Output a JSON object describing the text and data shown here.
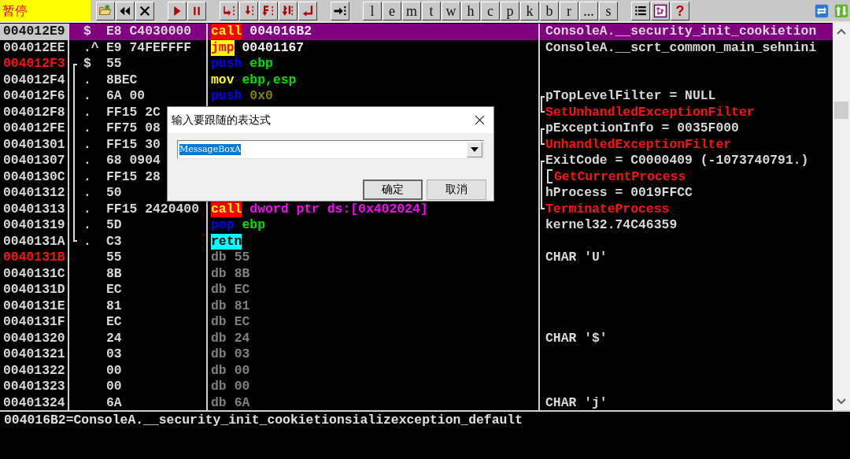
{
  "toolbar": {
    "status": "暂停",
    "groups": [
      [
        {
          "kind": "open"
        },
        {
          "kind": "rewind"
        },
        {
          "kind": "close"
        }
      ],
      [
        {
          "kind": "run"
        },
        {
          "kind": "pause"
        }
      ],
      [
        {
          "kind": "step-into"
        },
        {
          "kind": "step-over"
        },
        {
          "kind": "trace-into"
        },
        {
          "kind": "trace-over"
        },
        {
          "kind": "till-return"
        }
      ],
      [
        {
          "kind": "goto"
        }
      ],
      [
        {
          "kind": "letter",
          "label": "l"
        },
        {
          "kind": "letter",
          "label": "e"
        },
        {
          "kind": "letter",
          "label": "m"
        },
        {
          "kind": "letter",
          "label": "t"
        },
        {
          "kind": "letter",
          "label": "w"
        },
        {
          "kind": "letter",
          "label": "h"
        },
        {
          "kind": "letter",
          "label": "c"
        },
        {
          "kind": "letter",
          "label": "p"
        },
        {
          "kind": "letter",
          "label": "k"
        },
        {
          "kind": "letter",
          "label": "b"
        },
        {
          "kind": "letter",
          "label": "r"
        },
        {
          "kind": "letter",
          "label": "..."
        },
        {
          "kind": "letter",
          "label": "s"
        }
      ],
      [
        {
          "kind": "list"
        },
        {
          "kind": "windows"
        },
        {
          "kind": "letter-help",
          "label": "?"
        }
      ],
      [
        {
          "kind": "swap"
        },
        {
          "kind": "updown"
        }
      ]
    ]
  },
  "disassembly": {
    "rows": [
      {
        "address": "004012E9",
        "breakpoint": false,
        "selected": true,
        "in_jump_bracket": false,
        "marker": "$",
        "hex": "E8 C4030000",
        "mnemonic": "call",
        "operands": [
          {
            "text": "004016B2",
            "kind": "address"
          }
        ],
        "comment": {
          "text": "ConsoleA.__security_init_cookietion",
          "kind": "note",
          "in_bracket": false
        }
      },
      {
        "address": "004012EE",
        "breakpoint": false,
        "selected": false,
        "in_jump_bracket": false,
        "marker": ".^",
        "hex": "E9 74FEFFFF",
        "mnemonic": "jmp",
        "operands": [
          {
            "text": "00401167",
            "kind": "address"
          }
        ],
        "comment": {
          "text": "ConsoleA.__scrt_common_main_sehnini",
          "kind": "note",
          "in_bracket": false
        }
      },
      {
        "address": "004012F3",
        "breakpoint": true,
        "selected": false,
        "in_jump_bracket": true,
        "marker": "$",
        "hex": "55",
        "mnemonic": "push",
        "operands": [
          {
            "text": "ebp",
            "kind": "register"
          }
        ]
      },
      {
        "address": "004012F4",
        "breakpoint": false,
        "selected": false,
        "in_jump_bracket": true,
        "marker": ".",
        "hex": "8BEC",
        "mnemonic": "mov",
        "operands": [
          {
            "text": "ebp,esp",
            "kind": "register"
          }
        ]
      },
      {
        "address": "004012F6",
        "breakpoint": false,
        "selected": false,
        "in_jump_bracket": true,
        "marker": ".",
        "hex": "6A 00",
        "mnemonic": "push",
        "operands": [
          {
            "text": "0x0",
            "kind": "const"
          }
        ],
        "comment": {
          "text": "pTopLevelFilter = NULL",
          "kind": "note",
          "in_bracket": true,
          "bracket_start": true,
          "call_bracket": false
        }
      },
      {
        "address": "004012F8",
        "breakpoint": false,
        "selected": false,
        "in_jump_bracket": true,
        "marker": ".",
        "hex": "FF15 2C",
        "comment": {
          "text": "SetUnhandledExceptionFilter",
          "kind": "api",
          "in_bracket": true,
          "bracket_start": false,
          "call_bracket": false
        }
      },
      {
        "address": "004012FE",
        "breakpoint": false,
        "selected": false,
        "in_jump_bracket": true,
        "marker": ".",
        "hex": "FF75 08",
        "comment": {
          "text": "pExceptionInfo = 0035F000",
          "kind": "note",
          "in_bracket": true,
          "bracket_start": true,
          "call_bracket": false
        }
      },
      {
        "address": "00401301",
        "breakpoint": false,
        "selected": false,
        "in_jump_bracket": true,
        "marker": ".",
        "hex": "FF15 30",
        "comment": {
          "text": "UnhandledExceptionFilter",
          "kind": "api",
          "in_bracket": true,
          "bracket_start": false,
          "call_bracket": false
        }
      },
      {
        "address": "00401307",
        "breakpoint": false,
        "selected": false,
        "in_jump_bracket": true,
        "marker": ".",
        "hex": "68 0904",
        "comment": {
          "text": "ExitCode = C0000409 (-1073740791.)",
          "kind": "note",
          "in_bracket": true,
          "bracket_start": true,
          "call_bracket": false
        }
      },
      {
        "address": "0040130C",
        "breakpoint": false,
        "selected": false,
        "in_jump_bracket": true,
        "marker": ".",
        "hex": "FF15 28",
        "comment": {
          "text": "GetCurrentProcess",
          "kind": "api",
          "in_bracket": true,
          "bracket_start": false,
          "call_bracket": true
        }
      },
      {
        "address": "00401312",
        "breakpoint": false,
        "selected": false,
        "in_jump_bracket": true,
        "marker": ".",
        "hex": "50",
        "comment": {
          "text": "hProcess = 0019FFCC",
          "kind": "note",
          "in_bracket": true,
          "bracket_start": false,
          "call_bracket": false
        }
      },
      {
        "address": "00401313",
        "breakpoint": false,
        "selected": false,
        "in_jump_bracket": true,
        "marker": ".",
        "hex": "FF15 2420400",
        "mnemonic": "call",
        "operands": [
          {
            "text": "dword ptr ds:[0x402024]",
            "kind": "memory"
          }
        ],
        "comment": {
          "text": "TerminateProcess",
          "kind": "api",
          "in_bracket": true,
          "bracket_start": false,
          "call_bracket": false
        }
      },
      {
        "address": "00401319",
        "breakpoint": false,
        "selected": false,
        "in_jump_bracket": true,
        "marker": ".",
        "hex": "5D",
        "mnemonic": "pop",
        "operands": [
          {
            "text": "ebp",
            "kind": "register"
          }
        ],
        "comment": {
          "text": "kernel32.74C46359",
          "kind": "note",
          "in_bracket": false
        }
      },
      {
        "address": "0040131A",
        "breakpoint": false,
        "selected": false,
        "in_jump_bracket": true,
        "marker": ".",
        "hex": "C3",
        "mnemonic": "retn"
      },
      {
        "address": "0040131B",
        "breakpoint": true,
        "selected": false,
        "in_jump_bracket": false,
        "hex": "55",
        "mnemonic": "db",
        "operands": [
          {
            "text": "55",
            "kind": "data"
          }
        ],
        "comment": {
          "text": "CHAR 'U'",
          "kind": "note",
          "in_bracket": false
        }
      },
      {
        "address": "0040131C",
        "breakpoint": false,
        "selected": false,
        "in_jump_bracket": false,
        "hex": "8B",
        "mnemonic": "db",
        "operands": [
          {
            "text": "8B",
            "kind": "data"
          }
        ]
      },
      {
        "address": "0040131D",
        "breakpoint": false,
        "selected": false,
        "in_jump_bracket": false,
        "hex": "EC",
        "mnemonic": "db",
        "operands": [
          {
            "text": "EC",
            "kind": "data"
          }
        ]
      },
      {
        "address": "0040131E",
        "breakpoint": false,
        "selected": false,
        "in_jump_bracket": false,
        "hex": "81",
        "mnemonic": "db",
        "operands": [
          {
            "text": "81",
            "kind": "data"
          }
        ]
      },
      {
        "address": "0040131F",
        "breakpoint": false,
        "selected": false,
        "in_jump_bracket": false,
        "hex": "EC",
        "mnemonic": "db",
        "operands": [
          {
            "text": "EC",
            "kind": "data"
          }
        ]
      },
      {
        "address": "00401320",
        "breakpoint": false,
        "selected": false,
        "in_jump_bracket": false,
        "hex": "24",
        "mnemonic": "db",
        "operands": [
          {
            "text": "24",
            "kind": "data"
          }
        ],
        "comment": {
          "text": "CHAR '$'",
          "kind": "note",
          "in_bracket": false
        }
      },
      {
        "address": "00401321",
        "breakpoint": false,
        "selected": false,
        "in_jump_bracket": false,
        "hex": "03",
        "mnemonic": "db",
        "operands": [
          {
            "text": "03",
            "kind": "data"
          }
        ]
      },
      {
        "address": "00401322",
        "breakpoint": false,
        "selected": false,
        "in_jump_bracket": false,
        "hex": "00",
        "mnemonic": "db",
        "operands": [
          {
            "text": "00",
            "kind": "data"
          }
        ]
      },
      {
        "address": "00401323",
        "breakpoint": false,
        "selected": false,
        "in_jump_bracket": false,
        "hex": "00",
        "mnemonic": "db",
        "operands": [
          {
            "text": "00",
            "kind": "data"
          }
        ]
      },
      {
        "address": "00401324",
        "breakpoint": false,
        "selected": false,
        "in_jump_bracket": false,
        "hex": "6A",
        "mnemonic": "db",
        "operands": [
          {
            "text": "6A",
            "kind": "data"
          }
        ],
        "comment": {
          "text": "CHAR 'j'",
          "kind": "note",
          "in_bracket": false
        }
      }
    ]
  },
  "info_pane": "004016B2=ConsoleA.__security_init_cookietionsializexception_default",
  "dialog": {
    "title": "输入要跟随的表达式",
    "expression": {
      "value": "MessageBoxA",
      "selected": true
    },
    "buttons": [
      {
        "label": "确定",
        "default": true
      },
      {
        "label": "取消",
        "default": false
      }
    ]
  }
}
